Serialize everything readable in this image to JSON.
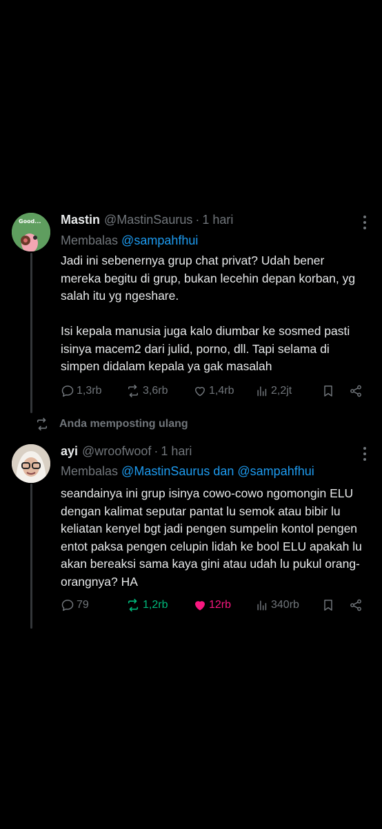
{
  "tweets": [
    {
      "display_name": "Mastin",
      "handle": "@MastinSaurus",
      "separator": "·",
      "time": "1 hari",
      "reply_prefix": "Membalas",
      "reply_mentions": "@sampahfhui",
      "avatar_text": "Good...",
      "text": "Jadi ini sebenernya grup chat privat? Udah bener mereka begitu di grup, bukan lecehin depan korban, yg salah itu yg ngeshare.\n\nIsi kepala manusia juga kalo diumbar ke sosmed pasti isinya macem2 dari julid, porno, dll. Tapi selama di simpen didalam kepala ya gak masalah",
      "replies": "1,3rb",
      "reposts": "3,6rb",
      "likes": "1,4rb",
      "views": "2,2jt"
    },
    {
      "display_name": "ayi",
      "handle": "@wroofwoof",
      "separator": "·",
      "time": "1 hari",
      "reply_prefix": "Membalas",
      "reply_mentions": "@MastinSaurus dan @sampahfhui",
      "text": "seandainya ini grup isinya cowo-cowo ngomongin ELU dengan kalimat seputar pantat lu semok atau bibir lu keliatan kenyel bgt jadi pengen sumpelin kontol pengen entot paksa pengen celupin lidah ke bool ELU apakah lu akan bereaksi sama kaya gini atau udah lu pukul orang-orangnya? HA",
      "replies": "79",
      "reposts": "1,2rb",
      "likes": "12rb",
      "views": "340rb"
    }
  ],
  "repost_banner": "Anda memposting ulang",
  "colors": {
    "background": "#000000",
    "text": "#e7e9ea",
    "secondary": "#71767b",
    "link": "#1d9bf0",
    "repost_active": "#00ba7c",
    "like_active": "#f91880"
  }
}
